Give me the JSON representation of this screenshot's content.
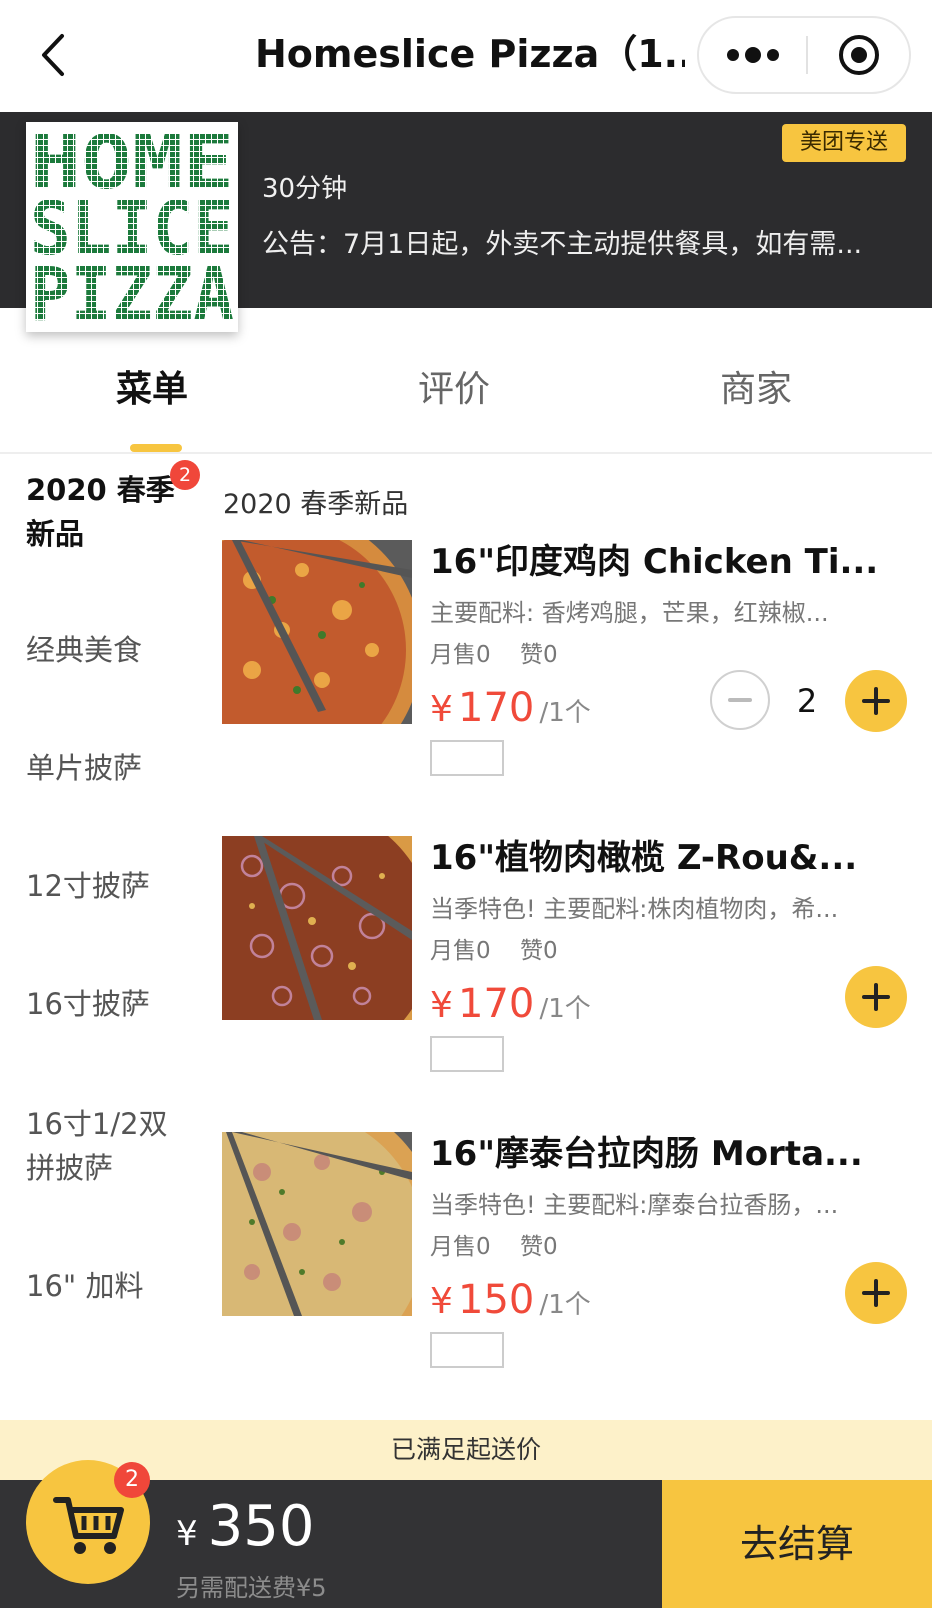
{
  "header": {
    "title": "Homeslice Pizza（1...",
    "back_icon": "chevron-left-icon",
    "more_icon": "more-dots-icon",
    "close_icon": "target-circle-icon"
  },
  "shop": {
    "logo_lines": [
      "HOME",
      "SLICE",
      "PIZZA"
    ],
    "tag": "美团专送",
    "delivery_time": "30分钟",
    "notice": "公告：7月1日起，外卖不主动提供餐具，如有需..."
  },
  "tabs": [
    {
      "label": "菜单",
      "active": true
    },
    {
      "label": "评价",
      "active": false
    },
    {
      "label": "商家",
      "active": false
    }
  ],
  "categories": [
    {
      "label": "2020 春季新品",
      "active": true,
      "badge": "2"
    },
    {
      "label": "经典美食"
    },
    {
      "label": "单片披萨"
    },
    {
      "label": "12寸披萨"
    },
    {
      "label": "16寸披萨"
    },
    {
      "label": "16寸1/2双拼披萨"
    },
    {
      "label": "16\" 加料"
    }
  ],
  "section_title": "2020 春季新品",
  "products": [
    {
      "name": "16\"印度鸡肉 Chicken Ti...",
      "desc": "主要配料: 香烤鸡腿，芒果，红辣椒...",
      "sales": "月售0",
      "likes": "赞0",
      "currency": "¥",
      "price": "170",
      "unit": "/1个",
      "quantity": "2"
    },
    {
      "name": "16\"植物肉橄榄 Z-Rou&...",
      "desc": "当季特色! 主要配料:株肉植物肉，希...",
      "sales": "月售0",
      "likes": "赞0",
      "currency": "¥",
      "price": "170",
      "unit": "/1个"
    },
    {
      "name": "16\"摩泰台拉肉肠 Morta...",
      "desc": "当季特色! 主要配料:摩泰台拉香肠，...",
      "sales": "月售0",
      "likes": "赞0",
      "currency": "¥",
      "price": "150",
      "unit": "/1个"
    }
  ],
  "min_order_note": "已满足起送价",
  "cart": {
    "badge": "2",
    "currency": "¥",
    "total": "350",
    "delivery_fee": "另需配送费¥5",
    "checkout_label": "去结算",
    "cart_icon": "shopping-cart-icon"
  },
  "colors": {
    "accent": "#f7c540",
    "price": "#f04a3a",
    "banner": "#2c2c2e",
    "badge": "#f0473a"
  }
}
